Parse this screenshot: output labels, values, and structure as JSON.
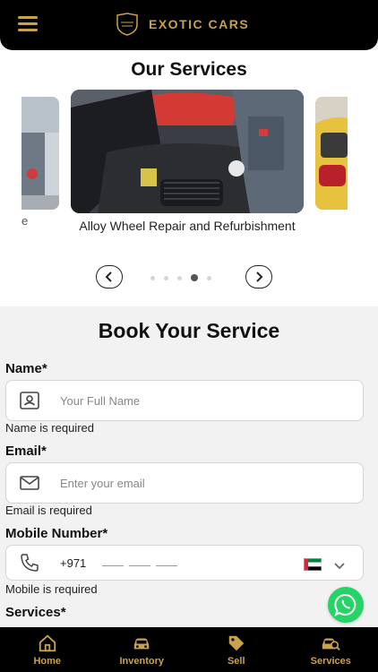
{
  "header": {
    "brand": "EXOTIC CARS"
  },
  "services": {
    "title": "Our Services",
    "left_caption": "e",
    "current_caption": "Alloy Wheel Repair and Refurbishment",
    "slide_count": 5,
    "active_slide": 4
  },
  "booking": {
    "title": "Book Your Service",
    "name": {
      "label": "Name*",
      "placeholder": "Your Full Name",
      "error": "Name is required"
    },
    "email": {
      "label": "Email*",
      "placeholder": "Enter your email",
      "error": "Email is required"
    },
    "mobile": {
      "label": "Mobile Number*",
      "country_code": "+971",
      "error": "Mobile is required"
    },
    "services_label": "Services*"
  },
  "bottom_nav": {
    "items": [
      {
        "label": "Home",
        "icon": "home-icon"
      },
      {
        "label": "Inventory",
        "icon": "car-icon"
      },
      {
        "label": "Sell",
        "icon": "tag-icon"
      },
      {
        "label": "Services",
        "icon": "car-service-icon"
      }
    ]
  },
  "colors": {
    "gold": "#c9a24a",
    "black": "#000000",
    "whatsapp": "#25d366"
  }
}
